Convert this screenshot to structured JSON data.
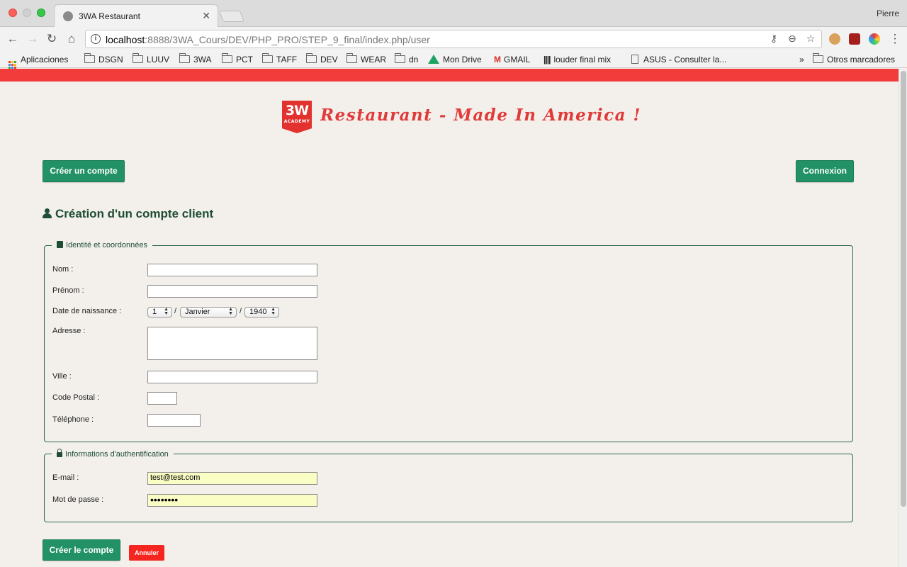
{
  "browser": {
    "tab_title": "3WA Restaurant",
    "profile_name": "Pierre",
    "url_host": "localhost",
    "url_path": ":8888/3WA_Cours/DEV/PHP_PRO/STEP_9_final/index.php/user",
    "bookmarks": {
      "apps": "Aplicaciones",
      "dsgn": "DSGN",
      "luuv": "LUUV",
      "3wa": "3WA",
      "pct": "PCT",
      "taff": "TAFF",
      "dev": "DEV",
      "wear": "WEAR",
      "dn": "dn",
      "drive": "Mon Drive",
      "gmail": "GMAIL",
      "louder": "louder final mix",
      "asus": "ASUS - Consulter la...",
      "more": "»",
      "other": "Otros marcadores"
    }
  },
  "header": {
    "logo_big": "3W",
    "logo_small": "ACADEMY",
    "brand": "Restaurant - Made In America !",
    "create_account": "Créer un compte",
    "login": "Connexion"
  },
  "form": {
    "title": "Création d'un compte client",
    "identity_legend": "Identité et coordonnées",
    "labels": {
      "nom": "Nom :",
      "prenom": "Prénom :",
      "birth": "Date de naissance :",
      "adresse": "Adresse :",
      "ville": "Ville :",
      "cp": "Code Postal :",
      "tel": "Téléphone :"
    },
    "birth": {
      "day": "1",
      "month": "Janvier",
      "year": "1940",
      "separator": "/"
    },
    "auth_legend": "Informations d'authentification",
    "email_label": "E-mail :",
    "email_value": "test@test.com",
    "password_label": "Mot de passe :",
    "password_value": "••••••••",
    "submit": "Créer le compte",
    "cancel": "Annuler"
  }
}
